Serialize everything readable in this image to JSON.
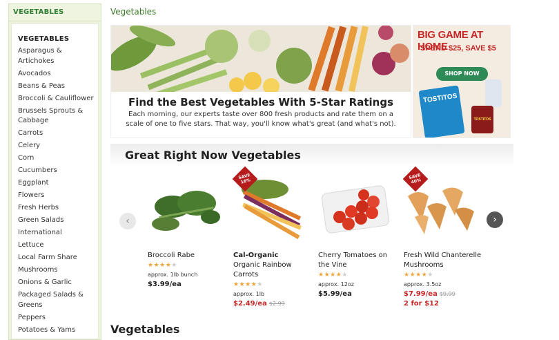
{
  "sidebar": {
    "header": "VEGETABLES",
    "title": "VEGETABLES",
    "items": [
      "Asparagus & Artichokes",
      "Avocados",
      "Beans & Peas",
      "Broccoli & Cauliflower",
      "Brussels Sprouts & Cabbage",
      "Carrots",
      "Celery",
      "Corn",
      "Cucumbers",
      "Eggplant",
      "Flowers",
      "Fresh Herbs",
      "Green Salads",
      "International",
      "Lettuce",
      "Local Farm Share",
      "Mushrooms",
      "Onions & Garlic",
      "Packaged Salads & Greens",
      "Peppers",
      "Potatoes & Yams"
    ]
  },
  "breadcrumb": "Vegetables",
  "hero": {
    "title": "Find the Best Vegetables With 5-Star Ratings",
    "subtitle": "Each morning, our experts taste over 800 fresh products and rate them on a scale of one to five stars. That way, you'll know what's great (and what's not)."
  },
  "ad": {
    "line1": "BIG GAME AT HOME",
    "line2": "SPEND $25, SAVE $5",
    "button": "SHOP NOW",
    "brand": "TOSTITOS",
    "jar": "TOSTITOS"
  },
  "section_title": "Great Right Now Vegetables",
  "carousel": {
    "prev_icon": "chevron-left-icon",
    "next_icon": "chevron-right-icon",
    "prev": "‹",
    "next": "›"
  },
  "products": [
    {
      "brand": "",
      "name": "Broccoli Rabe",
      "rating": 4,
      "qty": "approx. 1lb bunch",
      "price": "$3.99/ea",
      "was": "",
      "promo": "",
      "badge": ""
    },
    {
      "brand": "Cal-Organic",
      "name": "Organic Rainbow Carrots",
      "rating": 4,
      "qty": "approx. 1lb",
      "price": "$2.49/ea",
      "was": "$2.99",
      "promo": "",
      "badge": "SAVE 16%"
    },
    {
      "brand": "",
      "name": "Cherry Tomatoes on the Vine",
      "rating": 4,
      "qty": "approx. 12oz",
      "price": "$5.99/ea",
      "was": "",
      "promo": "",
      "badge": ""
    },
    {
      "brand": "",
      "name": "Fresh Wild Chanterelle Mushrooms",
      "rating": 4,
      "qty": "approx. 3.5oz",
      "price": "$7.99/ea",
      "was": "$9.99",
      "promo": "2 for $12",
      "badge": "SAVE 40%"
    }
  ],
  "bottom_heading": "Vegetables",
  "colors": {
    "brand_green": "#2e7d32",
    "sale_red": "#c62828",
    "star": "#f2a33a"
  }
}
